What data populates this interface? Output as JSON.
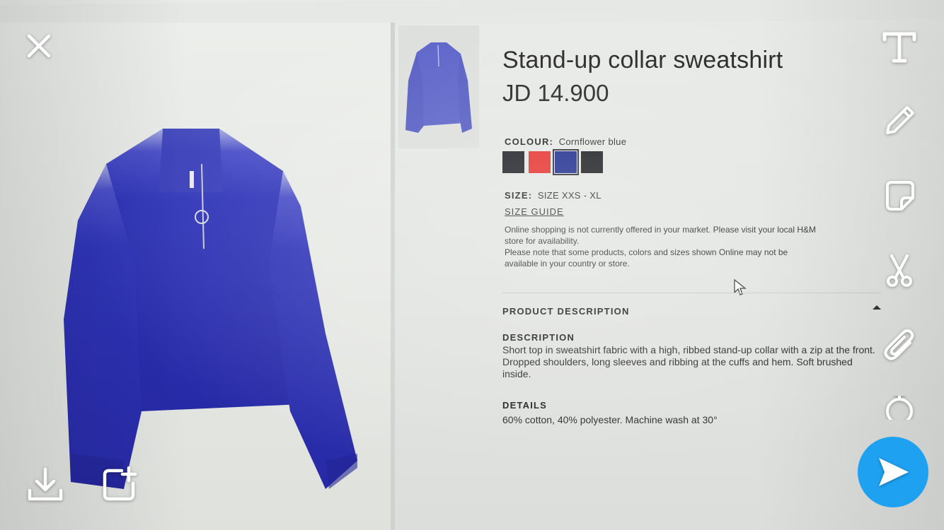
{
  "product": {
    "title": "Stand-up collar sweatshirt",
    "price": "JD 14.900",
    "colour_label": "COLOUR:",
    "colour_value": "Cornflower blue",
    "swatches": [
      "#1c1e24",
      "#e5302b",
      "#1b2a8c",
      "#1a1b1f"
    ],
    "selected_swatch": 2,
    "size_label": "SIZE:",
    "size_value": "SIZE XXS - XL",
    "size_guide": "SIZE GUIDE",
    "notice_1": "Online shopping is not currently offered in your market. Please visit your local H&M store for availability.",
    "notice_2": "Please note that some products, colors and sizes shown Online may not be available in your country or store.",
    "product_description_heading": "PRODUCT DESCRIPTION",
    "description_heading": "DESCRIPTION",
    "description_text": "Short top in sweatshirt fabric with a high, ribbed stand-up collar with a zip at the front. Dropped shoulders, long sleeves and ribbing at the cuffs and hem. Soft brushed inside.",
    "details_heading": "DETAILS",
    "details_text": "60% cotton, 40% polyester. Machine wash at 30°"
  },
  "overlay": {
    "tools": [
      "text-tool",
      "pencil-tool",
      "sticker-tool",
      "scissors-tool",
      "attachment-tool",
      "timer-tool"
    ],
    "accent": "#1ea1f1"
  }
}
